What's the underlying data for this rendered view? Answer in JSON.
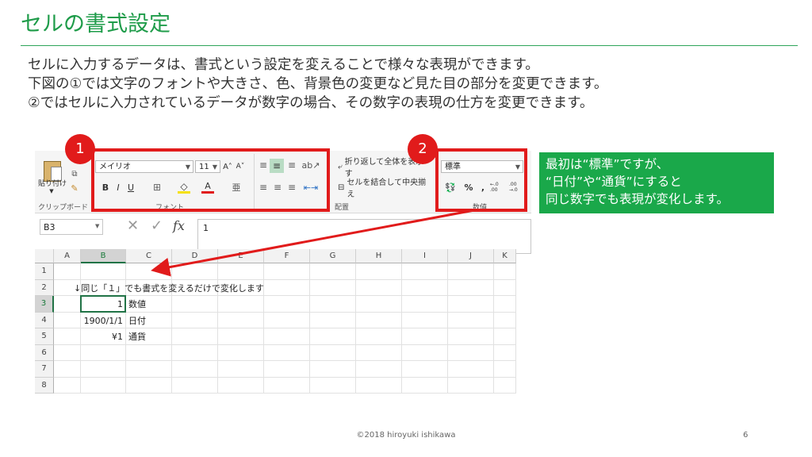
{
  "slide": {
    "title": "セルの書式設定",
    "lines": [
      "セルに入力するデータは、書式という設定を変えることで様々な表現ができます。",
      "下図の①では文字のフォントや大きさ、色、背景色の変更など見た目の部分を変更できます。",
      "②ではセルに入力されているデータが数字の場合、その数字の表現の仕方を変更できます。"
    ],
    "footer": "©2018 hiroyuki ishikawa",
    "page_number": "6"
  },
  "callouts": {
    "badge1": "1",
    "badge2": "2",
    "note_lines": [
      "最初は“標準”ですが、",
      "“日付”や“通貨”にすると",
      "同じ数字でも表現が変化します。"
    ],
    "accent": "#e11b1b",
    "note_color": "#1aa84a"
  },
  "ribbon": {
    "paste_label": "貼り付け",
    "clipboard_group": "クリップボード",
    "font_name": "メイリオ",
    "font_size": "11",
    "grow_font": "A˄",
    "shrink_font": "A˅",
    "bold": "B",
    "italic": "I",
    "underline": "U",
    "font_color_glyph": "A",
    "font_group": "フォント",
    "wrap_text": "折り返して全体を表示す",
    "merge_center": "セルを結合して中央揃え",
    "alignment_group": "配置",
    "number_format": "標準",
    "percent": "%",
    "comma": ",",
    "inc_decimal": "←.0 .00",
    "dec_decimal": ".00 →.0",
    "number_group": "数値"
  },
  "formula_bar": {
    "name_box": "B3",
    "fx": "fx",
    "value": "1"
  },
  "sheet": {
    "columns": [
      "A",
      "B",
      "C",
      "D",
      "E",
      "F",
      "G",
      "H",
      "I",
      "J",
      "K"
    ],
    "rows": [
      "1",
      "2",
      "3",
      "4",
      "5",
      "6",
      "7",
      "8"
    ],
    "row2_text": "↓同じ「１」でも書式を変えるだけで変化します",
    "b3": "1",
    "c3": "数値",
    "b4": "1900/1/1",
    "c4": "日付",
    "b5": "¥1",
    "c5": "通貨"
  }
}
